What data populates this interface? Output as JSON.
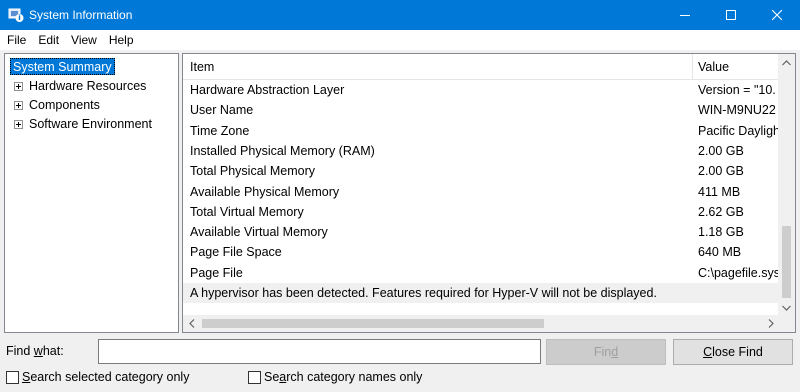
{
  "window": {
    "title": "System Information",
    "controls": [
      "minimize",
      "maximize",
      "close"
    ]
  },
  "menu": [
    "File",
    "Edit",
    "View",
    "Help"
  ],
  "tree": {
    "selected": "System Summary",
    "items": [
      "Hardware Resources",
      "Components",
      "Software Environment"
    ]
  },
  "list": {
    "columns": [
      "Item",
      "Value"
    ],
    "rows": [
      {
        "item": "Hardware Abstraction Layer",
        "value": "Version = \"10."
      },
      {
        "item": "User Name",
        "value": "WIN-M9NU22"
      },
      {
        "item": "Time Zone",
        "value": "Pacific Daylight"
      },
      {
        "item": "Installed Physical Memory (RAM)",
        "value": "2.00 GB"
      },
      {
        "item": "Total Physical Memory",
        "value": "2.00 GB"
      },
      {
        "item": "Available Physical Memory",
        "value": "411 MB"
      },
      {
        "item": "Total Virtual Memory",
        "value": "2.62 GB"
      },
      {
        "item": "Available Virtual Memory",
        "value": "1.18 GB"
      },
      {
        "item": "Page File Space",
        "value": "640 MB"
      },
      {
        "item": "Page File",
        "value": "C:\\pagefile.sys"
      },
      {
        "item": "A hypervisor has been detected. Features required for Hyper-V will not be displayed.",
        "value": ""
      }
    ]
  },
  "find": {
    "label_pre": "Find ",
    "label_u": "w",
    "label_post": "hat:",
    "value": "",
    "find_btn_pre": "Fin",
    "find_btn_u": "d",
    "close_btn_u": "C",
    "close_btn_post": "lose Find"
  },
  "checkboxes": [
    {
      "u": "S",
      "rest": "earch selected category only",
      "checked": false
    },
    {
      "pre": "Se",
      "u": "a",
      "rest": "rch category names only",
      "checked": false
    }
  ],
  "colors": {
    "titlebar": "#0078d7",
    "selection": "#0078d7"
  }
}
